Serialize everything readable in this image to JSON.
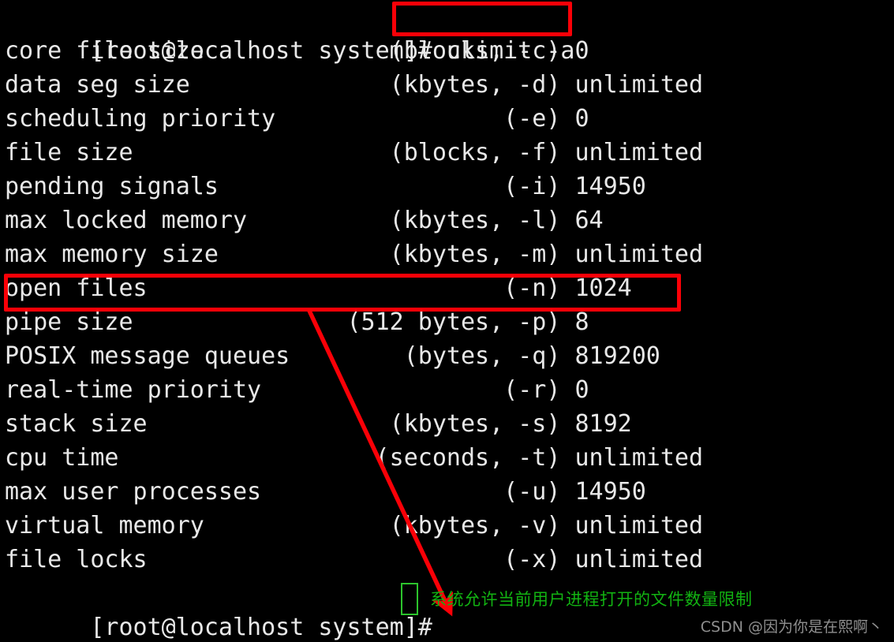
{
  "terminal": {
    "prompt_top": "[root@localhost system]# ",
    "command": "ulimit -a",
    "prompt_bottom": "[root@localhost system]# ",
    "lines": [
      {
        "label": "core file size",
        "units": "(blocks, -c)",
        "value": "0"
      },
      {
        "label": "data seg size",
        "units": "(kbytes, -d)",
        "value": "unlimited"
      },
      {
        "label": "scheduling priority",
        "units": "(-e)",
        "value": "0"
      },
      {
        "label": "file size",
        "units": "(blocks, -f)",
        "value": "unlimited"
      },
      {
        "label": "pending signals",
        "units": "(-i)",
        "value": "14950"
      },
      {
        "label": "max locked memory",
        "units": "(kbytes, -l)",
        "value": "64"
      },
      {
        "label": "max memory size",
        "units": "(kbytes, -m)",
        "value": "unlimited"
      },
      {
        "label": "open files",
        "units": "(-n)",
        "value": "1024"
      },
      {
        "label": "pipe size",
        "units": "(512 bytes, -p)",
        "value": "8"
      },
      {
        "label": "POSIX message queues",
        "units": "(bytes, -q)",
        "value": "819200"
      },
      {
        "label": "real-time priority",
        "units": "(-r)",
        "value": "0"
      },
      {
        "label": "stack size",
        "units": "(kbytes, -s)",
        "value": "8192"
      },
      {
        "label": "cpu time",
        "units": "(seconds, -t)",
        "value": "unlimited"
      },
      {
        "label": "max user processes",
        "units": "(-u)",
        "value": "14950"
      },
      {
        "label": "virtual memory",
        "units": "(kbytes, -v)",
        "value": "unlimited"
      },
      {
        "label": "file locks",
        "units": "(-x)",
        "value": "unlimited"
      }
    ]
  },
  "annotations": {
    "note_text": "系统允许当前用户进程打开的文件数量限制",
    "highlight_command": "ulimit -a",
    "highlight_row": "open files (-n) 1024",
    "box_color": "#fb0007",
    "note_color": "#12b312",
    "arrow_color": "#fb0007"
  },
  "watermark": {
    "text": "CSDN @因为你是在熙啊丶",
    "color": "#8f8f8f"
  },
  "theme": {
    "background": "#000000",
    "foreground": "#e8e8e8",
    "cursor_color": "#2cc42c"
  }
}
